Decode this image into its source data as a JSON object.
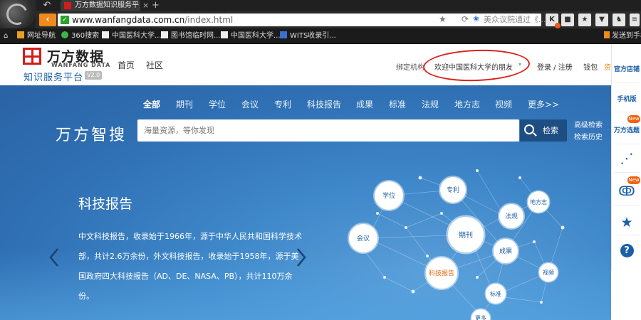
{
  "browser": {
    "tab_title": "万方数据知识服务平",
    "tab_close": "×",
    "new_tab": "+",
    "url_host": "www.wanfangdata.com.cn",
    "url_path": "/index.html",
    "search_box_text": "美众议院通过《...",
    "bookmarks": [
      "网址导航",
      "360搜索",
      "中国医科大学...",
      "图书馆临时网...",
      "中国医科大学...",
      "WITS收录引..."
    ],
    "send_to_phone": "发送到手机"
  },
  "header": {
    "logo_cn": "万方数据",
    "logo_en": "WANFANG DATA",
    "logo_sub": "知识服务平台",
    "logo_version": "V2.0",
    "nav": [
      "首页",
      "社区"
    ],
    "bind_institution": "绑定机构",
    "welcome": "欢迎中国医科大学的朋友",
    "login": "登录 / 注册",
    "wallet": "钱包",
    "cut_char": "资"
  },
  "hero": {
    "categories": [
      "全部",
      "期刊",
      "学位",
      "会议",
      "专利",
      "科技报告",
      "成果",
      "标准",
      "法规",
      "地方志",
      "视频",
      "更多>>"
    ],
    "active_category": "全部",
    "brand": "万方智搜",
    "search_placeholder": "海量资源，等你发现",
    "search_button": "检索",
    "advanced_search": "高级检索",
    "search_history": "检索历史",
    "slide_title": "科技报告",
    "slide_desc": "中文科技报告，收录始于1966年，源于中华人民共和国科学技术部，共计2.6万余份，外文科技报告，收录始于1958年，源于美国政府四大科技报告（AD、DE、NASA、PB），共计110万余份。",
    "bubbles": [
      "学位",
      "专利",
      "地方志",
      "法规",
      "期刊",
      "会议",
      "成果",
      "科技报告",
      "视频",
      "标准",
      "更多"
    ]
  },
  "rail": {
    "shop": "官方店铺",
    "mobile": "手机版",
    "topic": "万方选题",
    "new_badge": "New"
  },
  "colors": {
    "brand_red": "#d21c1c",
    "brand_blue": "#1a5fa8",
    "annotation_red": "#d8231b",
    "search_button": "#1e4d82"
  }
}
